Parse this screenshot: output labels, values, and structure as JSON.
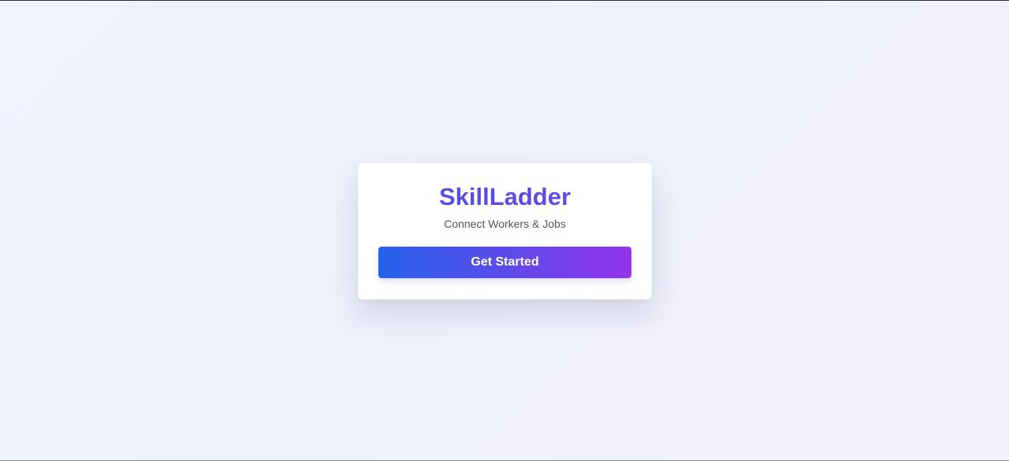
{
  "card": {
    "title": "SkillLadder",
    "subtitle": "Connect Workers & Jobs",
    "cta_label": "Get Started"
  },
  "colors": {
    "title_gradient_start": "#4a54e1",
    "title_gradient_end": "#6d44e2",
    "button_gradient_start": "#2563eb",
    "button_gradient_end": "#9333ea",
    "subtitle": "#4b5563",
    "background": "#eef2fc"
  }
}
